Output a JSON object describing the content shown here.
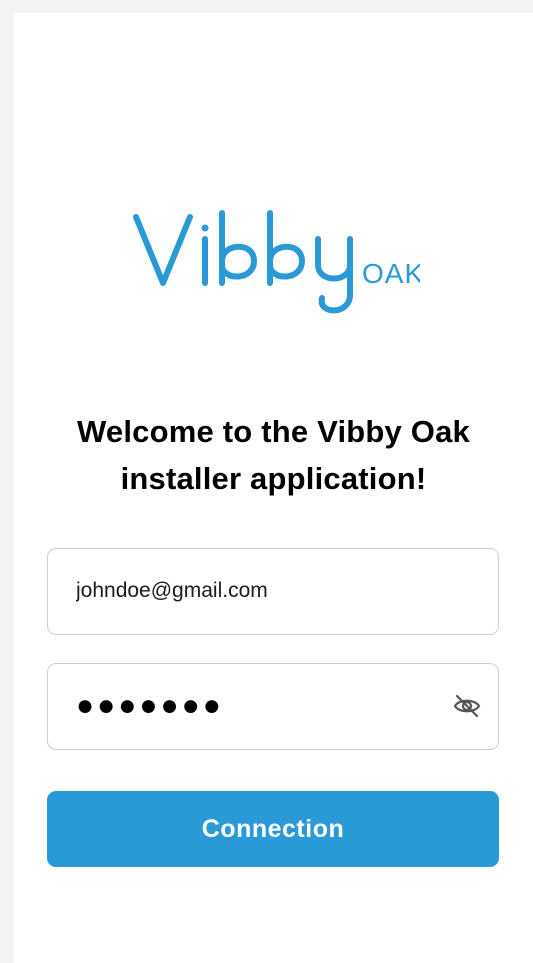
{
  "logo": {
    "brand": "Vibby",
    "suffix": "OAK",
    "color": "#2a9ad6"
  },
  "welcome": {
    "line1": "Welcome to the Vibby Oak",
    "line2": "installer application!"
  },
  "form": {
    "email_value": "johndoe@gmail.com",
    "password_value": "●●●●●●●",
    "eye_icon": "eye-off-icon",
    "submit_label": "Connection"
  },
  "colors": {
    "accent": "#2a9ad6",
    "border": "#cfcfcf"
  }
}
